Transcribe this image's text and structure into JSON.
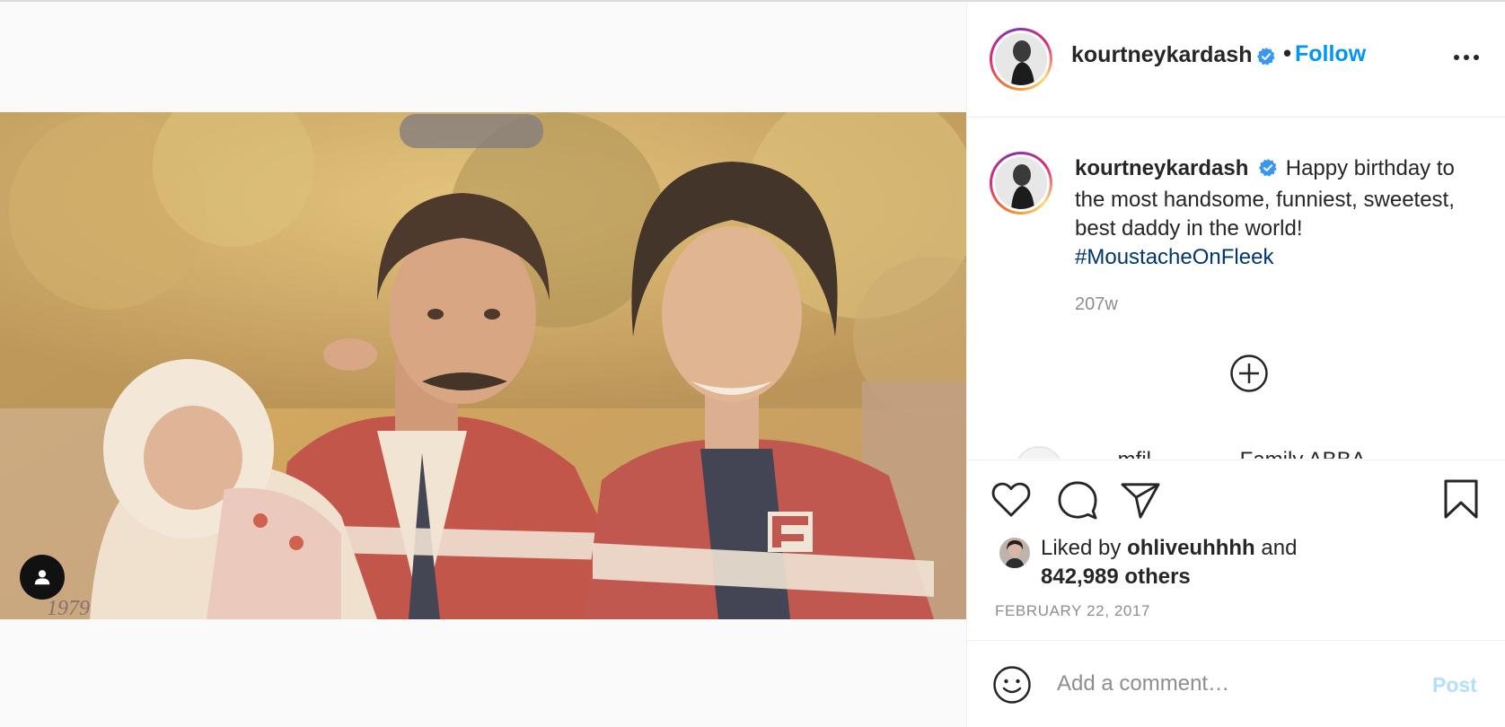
{
  "header": {
    "username": "kourtneykardash",
    "verified": true,
    "separator": "•",
    "follow_label": "Follow",
    "more_icon": "more-horizontal-icon"
  },
  "caption": {
    "username": "kourtneykardash",
    "text": "Happy birthday to the most handsome, funniest, sweetest, best daddy in the world!",
    "hashtag": "#MoustacheOnFleek",
    "time": "207w"
  },
  "partial_comment": {
    "text": "… mfil … … … Family ABBA"
  },
  "actions": {
    "like_icon": "heart-icon",
    "comment_icon": "comment-bubble-icon",
    "share_icon": "paper-plane-icon",
    "save_icon": "bookmark-icon"
  },
  "likes": {
    "prefix": "Liked by",
    "user": "ohliveuhhhh",
    "connector": "and",
    "others": "842,989 others"
  },
  "date": "FEBRUARY 22, 2017",
  "comment_box": {
    "placeholder": "Add a comment…",
    "post_label": "Post"
  },
  "colors": {
    "follow": "#0095f6",
    "hashtag": "#00376b",
    "muted": "#8e8e8e",
    "post_disabled": "#b2dffc",
    "verified": "#3897f0"
  },
  "photo": {
    "tag_icon": "user-tag-icon",
    "handwritten_year": "1979"
  }
}
